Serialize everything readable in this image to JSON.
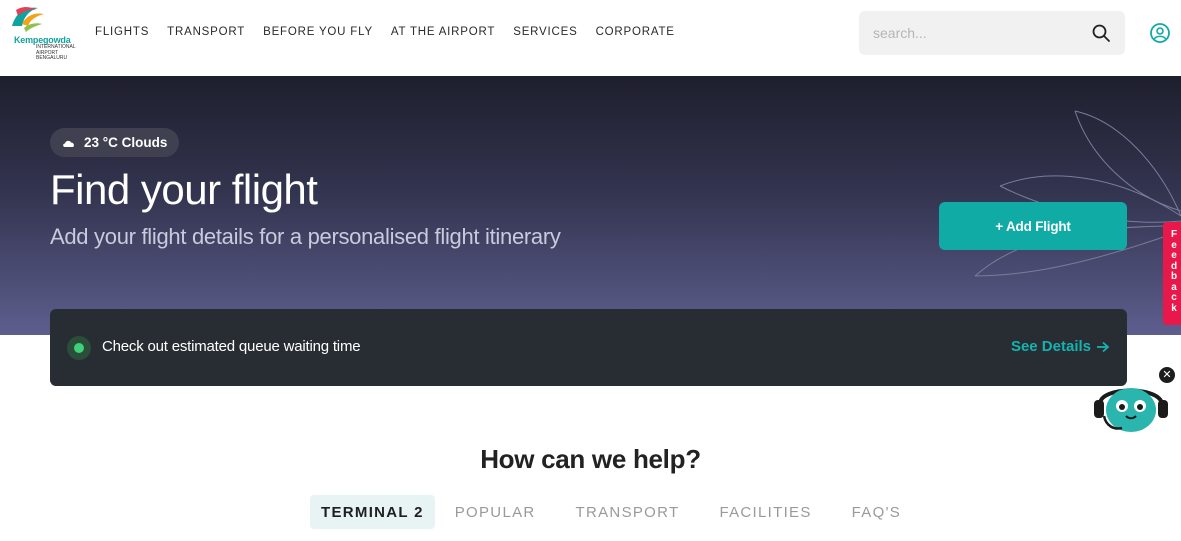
{
  "header": {
    "logo": {
      "name": "Kempegowda",
      "subtitle": "International Airport Bengaluru"
    },
    "nav": [
      "FLIGHTS",
      "TRANSPORT",
      "BEFORE YOU FLY",
      "AT THE AIRPORT",
      "SERVICES",
      "CORPORATE"
    ],
    "search": {
      "placeholder": "search...",
      "value": ""
    }
  },
  "hero": {
    "weather": "23 °C  Clouds",
    "title": "Find your flight",
    "subtitle": "Add your flight details for a personalised flight itinerary",
    "add_flight_label": "+ Add Flight"
  },
  "feedback": {
    "letters": [
      "F",
      "e",
      "e",
      "d",
      "b",
      "a",
      "c",
      "k"
    ]
  },
  "queue": {
    "text": "Check out estimated queue waiting time",
    "link_label": "See Details"
  },
  "chatbot": {
    "close_label": "✕"
  },
  "help": {
    "title": "How can we help?",
    "tabs": [
      "TERMINAL 2",
      "POPULAR",
      "TRANSPORT",
      "FACILITIES",
      "FAQ'S"
    ],
    "active_tab": "TERMINAL 2"
  },
  "colors": {
    "accent": "#11aba6",
    "feedback": "#e8194a",
    "banner": "#272d33"
  }
}
